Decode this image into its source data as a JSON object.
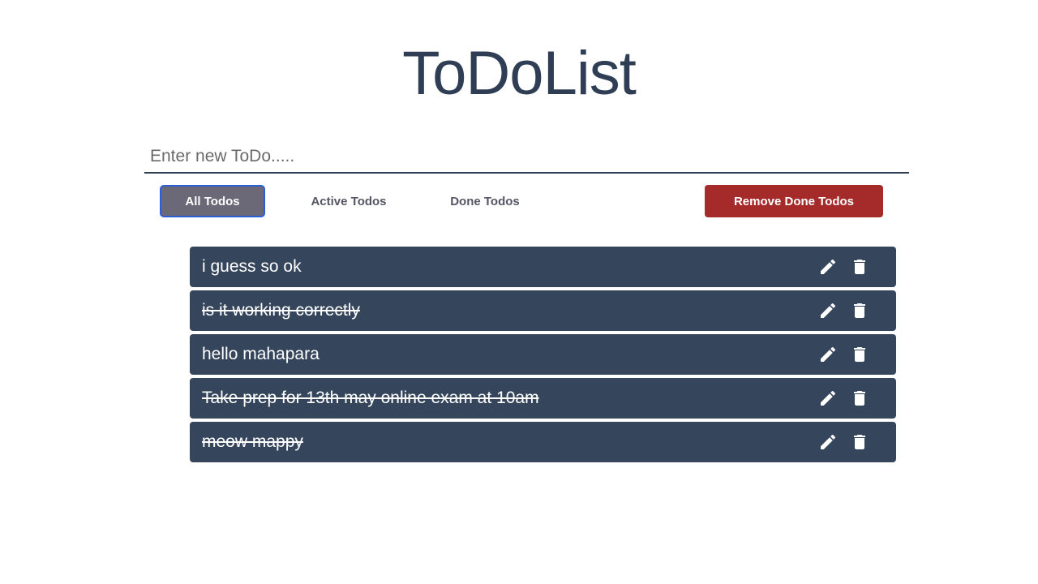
{
  "app": {
    "title": "ToDoList"
  },
  "input": {
    "placeholder": "Enter new ToDo.....",
    "value": ""
  },
  "filters": {
    "all_label": "All Todos",
    "active_label": "Active Todos",
    "done_label": "Done Todos",
    "selected": "All Todos"
  },
  "actions": {
    "remove_done_label": "Remove Done Todos"
  },
  "todos": [
    {
      "text": "i guess so ok",
      "done": false
    },
    {
      "text": "is it working correctly",
      "done": true
    },
    {
      "text": "hello mahapara",
      "done": false
    },
    {
      "text": "Take prep for 13th may online exam at 10am",
      "done": true
    },
    {
      "text": "meow mappy",
      "done": true
    }
  ],
  "icons": {
    "edit": "pencil-icon",
    "delete": "trash-icon"
  },
  "colors": {
    "title": "#2f3e54",
    "item_bg": "#35465c",
    "active_filter_bg": "#6b6878",
    "active_filter_border": "#2c5fd3",
    "danger": "#a52a2a"
  }
}
